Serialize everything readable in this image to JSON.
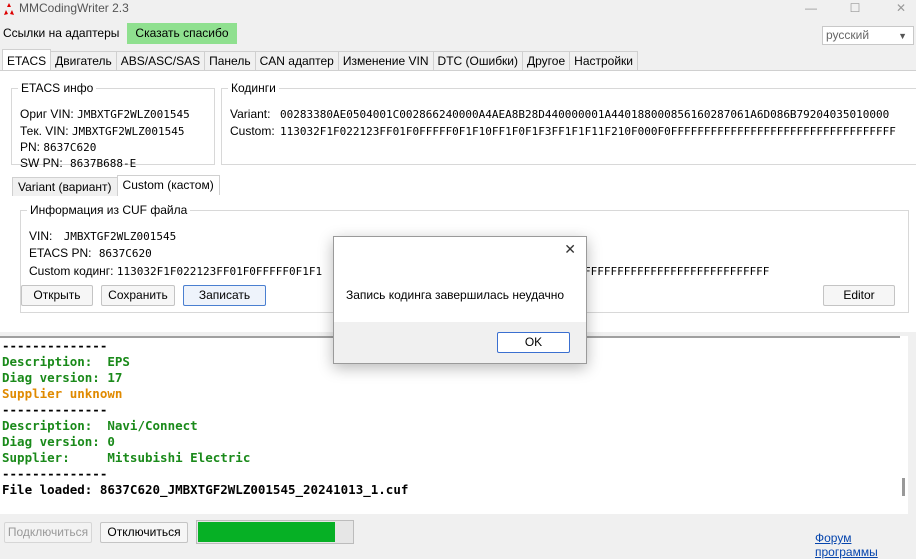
{
  "window": {
    "title": "MMCodingWriter 2.3"
  },
  "menu": {
    "adapter_links": "Ссылки на адаптеры",
    "thanks": "Сказать спасибо",
    "language": "русский"
  },
  "tabs": [
    "ETACS",
    "Двигатель",
    "ABS/ASC/SAS",
    "Панель",
    "CAN адаптер",
    "Изменение VIN",
    "DTC (Ошибки)",
    "Другое",
    "Настройки"
  ],
  "etacs_info": {
    "legend": "ETACS инфо",
    "orig_vin_label": "Ориг VIN:",
    "orig_vin": "JMBXTGF2WLZ001545",
    "tek_vin_label": "Тек. VIN:",
    "tek_vin": "JMBXTGF2WLZ001545",
    "pn_label": "PN:",
    "pn": "8637C620",
    "swpn_label": "SW PN:",
    "swpn": "8637B688-E"
  },
  "codings": {
    "legend": "Кодинги",
    "variant_label": "Variant:",
    "variant": "00283380AE0504001C002866240000A4AEA8B28D440000001A440188000856160287061A6D086B79204035010000",
    "custom_label": "Custom:",
    "custom": "113032F1F022123FF01F0FFFFF0F1F10FF1F0F1F3FF1F1F11F210F000F0FFFFFFFFFFFFFFFFFFFFFFFFFFFFFFFFFF"
  },
  "subtabs": [
    "Variant (вариант)",
    "Custom (кастом)"
  ],
  "cuf": {
    "legend": "Информация из CUF файла",
    "vin_label": "VIN:",
    "vin": "JMBXTGF2WLZ001545",
    "pn_label": "ETACS PN:",
    "pn": "8637C620",
    "coding_label": "Custom кодинг:",
    "coding": "113032F1F022123FF01F0FFFFF0F1F1",
    "coding_tail": "FFFFFFFFFFFFFFFFFFFFFFFFFFFF"
  },
  "buttons": {
    "open": "Открыть",
    "save": "Сохранить",
    "write": "Записать",
    "editor": "Editor"
  },
  "console": {
    "lines": [
      {
        "text": "--------------",
        "color": "#000000"
      },
      {
        "text": "Description:  EPS",
        "color": "#1a8a1a"
      },
      {
        "text": "Diag version: 17",
        "color": "#1a8a1a"
      },
      {
        "text": "Supplier unknown",
        "color": "#e08a00"
      },
      {
        "text": "--------------",
        "color": "#000000"
      },
      {
        "text": "Description:  Navi/Connect",
        "color": "#1a8a1a"
      },
      {
        "text": "Diag version: 0",
        "color": "#1a8a1a"
      },
      {
        "text": "Supplier:     Mitsubishi Electric",
        "color": "#1a8a1a"
      },
      {
        "text": "--------------",
        "color": "#000000"
      },
      {
        "text": "File loaded: 8637C620_JMBXTGF2WLZ001545_20241013_1.cuf",
        "color": "#000000"
      }
    ]
  },
  "bottom": {
    "connect": "Подключиться",
    "disconnect": "Отключиться",
    "progress": 0.88,
    "forum": "Форум программы"
  },
  "dialog": {
    "message": "Запись кодинга завершилась неудачно",
    "ok": "OK"
  }
}
